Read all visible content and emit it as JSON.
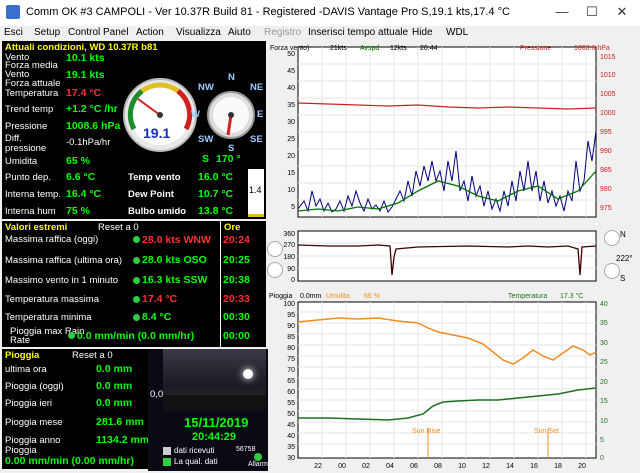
{
  "window": {
    "title": "Comm OK #3 CAMPOLI - Ver 10.37R Build 81 - Registered  -DAVIS Vantage Pro   S,19.1 kts,17.4 °C",
    "min": "—",
    "max": "☐",
    "close": "✕"
  },
  "menu": [
    "Esci",
    "Setup",
    "Control Panel",
    "Action",
    "Visualizza",
    "Aiuto",
    "Registro",
    "Inserisci tempo attuale",
    "Hide",
    "WDL"
  ],
  "current": {
    "header": "Attuali condizioni, WD 10.37R b81",
    "rows": [
      {
        "label": "Vento",
        "value": "10.1 kts"
      },
      {
        "label": "Forza media",
        "value": ""
      },
      {
        "label": "Vento",
        "value": "19.1 kts"
      },
      {
        "label": "Forza attuale",
        "value": ""
      },
      {
        "label": "Temperatura",
        "value": "17.4 °C"
      },
      {
        "label": "Trend temp",
        "value": "+1.2 °C /hr"
      },
      {
        "label": "Pressione",
        "value": "1008.6 hPa"
      },
      {
        "label": "Diff. pressione",
        "value": "-0.1hPa/hr"
      },
      {
        "label": "Umidita",
        "value": "65 %"
      },
      {
        "label": "Punto dep.",
        "value": "6.6 °C"
      },
      {
        "label": "Interna temp.",
        "value": "16.4 °C"
      },
      {
        "label": "Interna hum",
        "value": "75 %"
      }
    ],
    "right_rows": [
      {
        "label": "Temp vento",
        "value": "16.0 °C"
      },
      {
        "label": "Dew Point",
        "value": "10.7 °C"
      },
      {
        "label": "Bulbo umido",
        "value": "13.8 °C"
      }
    ],
    "gauge_speed": "19.1",
    "compass_dir": "S",
    "compass_deg": "170 °",
    "compass_labels": [
      "N",
      "NE",
      "E",
      "SE",
      "S",
      "SW",
      "W",
      "NW"
    ],
    "side_value": "1.4"
  },
  "extremes": {
    "header": "Valori estremi",
    "reset": "Reset a 0",
    "ore": "Ore",
    "rows": [
      {
        "label": "Massima raffica (oggi)",
        "value": "28.0 kts WNW",
        "time": "20:24"
      },
      {
        "label": "Massima raffica (ultima ora)",
        "value": "28.0 kts OSO",
        "time": "20:25"
      },
      {
        "label": "Massimo vento in 1 minuto",
        "value": "16.3 kts SSW",
        "time": "20:38"
      },
      {
        "label": "Temperatura massima",
        "value": "17.4 °C",
        "time": "20:33"
      },
      {
        "label": "Temperatura minima",
        "value": "8.4 °C",
        "time": "00:30"
      },
      {
        "label": "Pioggia max Rain Rate",
        "value": "0.0 mm/min (0.0 mm/hr)",
        "time": "00:00"
      }
    ]
  },
  "rain": {
    "header": "Pioggia",
    "reset": "Reset a 0",
    "rows": [
      {
        "label": "ultima ora",
        "value": "0.0 mm"
      },
      {
        "label": "Pioggia (oggi)",
        "value": "0.0 mm"
      },
      {
        "label": "Pioggia ieri",
        "value": "0.0 mm"
      },
      {
        "label": "Pioggia mese",
        "value": "281.6 mm"
      },
      {
        "label": "Pioggia anno",
        "value": "1134.2 mm"
      },
      {
        "label": "Pioggia",
        "value": ""
      }
    ],
    "rate": "0.00 mm/min (0.00 mm/hr)"
  },
  "cam": {
    "value": "0,0",
    "date": "15/11/2019",
    "time": "20:44:29",
    "dati_ricevuti": "dati ricevuti",
    "la_qual_dati": "La qual. dati",
    "count": "56758",
    "allarmi": "Allarmi"
  },
  "chart_top": {
    "labels": {
      "forza": "Forza vento)",
      "kts1": "21kts",
      "avspd": "Avspd",
      "kts2": "12kts",
      "time": "20:44",
      "pressione": "Pressione",
      "press_val": "1008.6 hPa"
    },
    "left_ticks": [
      "50",
      "45",
      "40",
      "35",
      "30",
      "25",
      "20",
      "15",
      "10",
      "5"
    ],
    "right_ticks": [
      "1015",
      "1010",
      "1005",
      "1000",
      "995",
      "990",
      "985",
      "980",
      "975"
    ]
  },
  "chart_dir": {
    "left_ticks": [
      "360",
      "270",
      "180",
      "90",
      "0"
    ],
    "right_labels": [
      "N",
      "S",
      "222°"
    ]
  },
  "chart_bottom": {
    "labels": {
      "pioggia": "Pioggia",
      "pioggia_val": "0.0mm",
      "umidita": "Umidita",
      "umidita_val": "66 %",
      "temperatura": "Temperatura",
      "temp_val": "17.3 °C",
      "sunrise": "Sun Rise",
      "sunset": "Sun Set"
    },
    "left_ticks": [
      "100",
      "95",
      "90",
      "85",
      "80",
      "75",
      "70",
      "65",
      "60",
      "55",
      "50",
      "45",
      "40",
      "35",
      "30"
    ],
    "right_ticks": [
      "40",
      "35",
      "30",
      "25",
      "20",
      "15",
      "10",
      "5",
      "0"
    ],
    "x_ticks": [
      "22",
      "00",
      "02",
      "04",
      "06",
      "08",
      "10",
      "12",
      "14",
      "16",
      "18",
      "20"
    ]
  },
  "colors": {
    "wind": "#000080",
    "avg": "#007000",
    "pressure": "#d02020",
    "humidity": "#f08c20",
    "temperature": "#207020",
    "direction": "#400000"
  }
}
